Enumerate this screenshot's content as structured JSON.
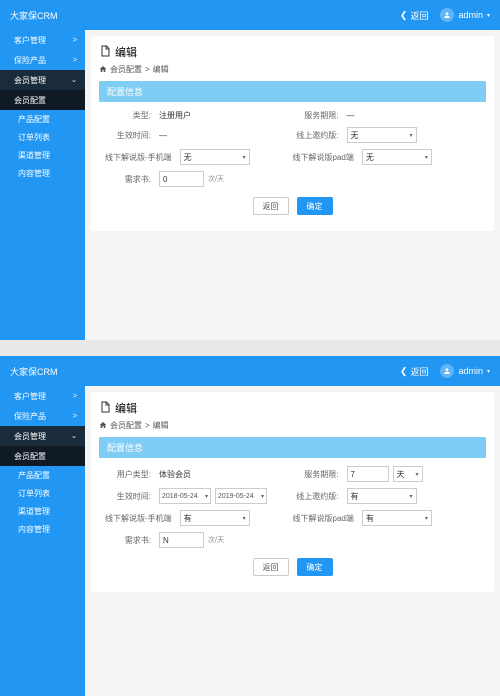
{
  "header": {
    "title": "大家保CRM",
    "back": "返回",
    "user": "admin"
  },
  "sidebar": {
    "items": [
      {
        "label": "客户管理",
        "chev": ">"
      },
      {
        "label": "保险产品",
        "chev": ">"
      },
      {
        "label": "会员管理",
        "chev": "⌄"
      },
      {
        "label": "会员配置"
      },
      {
        "label": "产品配置"
      },
      {
        "label": "订单列表"
      },
      {
        "label": "渠道管理"
      },
      {
        "label": "内容管理"
      }
    ]
  },
  "page": {
    "title": "编辑",
    "crumb1": "会员配置",
    "crumb2": "编辑",
    "section": "配置信息"
  },
  "labels": {
    "type": "类型:",
    "userType": "用户类型:",
    "effTime": "生效时间:",
    "offlineMobile": "线下解说版-手机端",
    "demand": "需求书:",
    "servicePeriod": "服务期限:",
    "onlineInvite": "线上邀约版:",
    "offlinePad": "线下解说版pad端",
    "unitDay": "次/天",
    "unitDays": "天"
  },
  "btns": {
    "back": "返回",
    "confirm": "确定"
  },
  "opts": {
    "none": "无",
    "has": "有"
  },
  "screen1": {
    "type": "注册用户",
    "effTime": "—",
    "offlineMobile": "无",
    "demand": "0",
    "servicePeriod": "—",
    "onlineInvite": "无",
    "offlinePad": "无"
  },
  "screen2": {
    "userType": "体验会员",
    "dateFrom": "2018-05-24",
    "dateTo": "2019-05-24",
    "offlineMobile": "有",
    "demand": "N",
    "servicePeriod": "7",
    "periodUnit": "天",
    "onlineInvite": "有",
    "offlinePad": "有"
  }
}
